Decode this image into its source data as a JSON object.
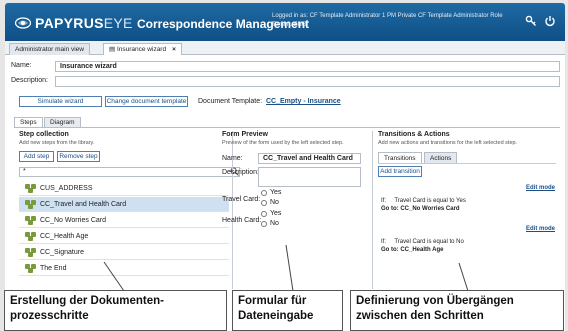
{
  "header": {
    "logo": "PAPYRUS",
    "logo_suffix": "EYE",
    "app_title": "Correspondence Management",
    "login_line1": "Logged in as: CF Template Administrator 1   PM Private CF Template Administrator Role",
    "login_line2": "Tenant: ENG",
    "icons": [
      "key-icon",
      "power-icon"
    ]
  },
  "tabs": [
    {
      "label": "Administrator main view"
    },
    {
      "label": "Insurance wizard",
      "close": "×"
    }
  ],
  "form": {
    "name_label": "Name:",
    "name_value": "Insurance wizard",
    "description_label": "Description:",
    "description_value": "",
    "simulate_button": "Simulate wizard",
    "change_template_button": "Change document template",
    "document_template_label": "Document Template:",
    "document_template_link": "CC_Empty - Insurance"
  },
  "subtabs": [
    {
      "label": "Steps"
    },
    {
      "label": "Diagram"
    }
  ],
  "step_collection": {
    "title": "Step collection",
    "subtitle": "Add new steps from the library.",
    "add_button": "Add step",
    "remove_button": "Remove step",
    "search_value": "*",
    "steps": [
      {
        "label": "CUS_ADDRESS"
      },
      {
        "label": "CC_Travel and Health Card"
      },
      {
        "label": "CC_No Worries Card"
      },
      {
        "label": "CC_Health Age"
      },
      {
        "label": "CC_Signature"
      },
      {
        "label": "The End"
      }
    ],
    "selected_index": 1
  },
  "form_preview": {
    "title": "Form Preview",
    "subtitle": "Preview of the form used by the left selected step.",
    "name_label": "Name:",
    "name_value": "CC_Travel and Health Card",
    "description_label": "Description:",
    "travel_label": "Travel Card:",
    "health_label": "Health Card:",
    "yes": "Yes",
    "no": "No"
  },
  "transitions": {
    "title": "Transitions & Actions",
    "subtitle": "Add new actions and transitions for the left selected step.",
    "tab_transitions": "Transitions",
    "tab_actions": "Actions",
    "add_button": "Add transition",
    "edit_mode": "Edit mode",
    "rules": [
      {
        "if_label": "If:",
        "if_text": "Travel Card is equal to Yes",
        "goto_label": "Go to:",
        "goto_text": "CC_No Worries Card"
      },
      {
        "if_label": "If:",
        "if_text": "Travel Card is equal to No",
        "goto_label": "Go to:",
        "goto_text": "CC_Health Age"
      }
    ]
  },
  "callouts": [
    {
      "line1": "Erstellung der Dokumenten-",
      "line2": "prozesschritte"
    },
    {
      "line1": "Formular für",
      "line2": "Dateneingabe"
    },
    {
      "line1": "Definierung von Übergängen",
      "line2": "zwischen den Schritten"
    }
  ],
  "colors": {
    "header": "#1a5f98",
    "accent": "#1b4f86",
    "selected_row": "#cfe0f1"
  }
}
